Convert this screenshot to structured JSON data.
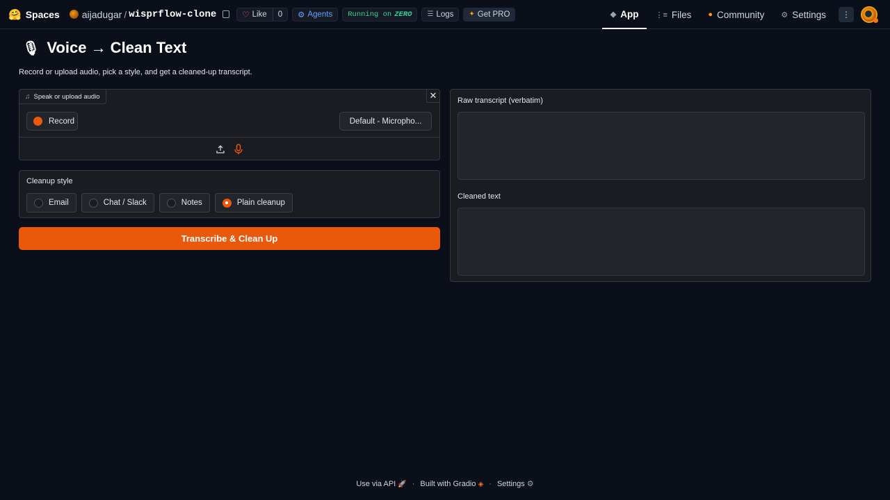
{
  "topbar": {
    "brand": "Spaces",
    "owner": "aijadugar",
    "slash": "/",
    "repo_name": "wisprflow-clone",
    "like_label": "Like",
    "like_count": "0",
    "agents_label": "Agents",
    "running_label": "Running on",
    "running_hw": "ZERO",
    "logs_label": "Logs",
    "pro_label": "Get PRO",
    "tabs": [
      {
        "label": "App",
        "icon": "cube-icon",
        "active": true
      },
      {
        "label": "Files",
        "icon": "files-icon",
        "active": false
      },
      {
        "label": "Community",
        "icon": "community-icon",
        "active": false
      },
      {
        "label": "Settings",
        "icon": "gear-icon",
        "active": false
      }
    ]
  },
  "page": {
    "title": "Voice → Clean Text",
    "description": "Record or upload audio, pick a style, and get a cleaned-up transcript."
  },
  "audio": {
    "label": "Speak or upload audio",
    "record_label": "Record",
    "device": "Default - Micropho..."
  },
  "style": {
    "title": "Cleanup style",
    "options": [
      "Email",
      "Chat / Slack",
      "Notes",
      "Plain cleanup"
    ],
    "selected": "Plain cleanup"
  },
  "submit_label": "Transcribe & Clean Up",
  "outputs": {
    "raw_label": "Raw transcript (verbatim)",
    "raw_value": "",
    "clean_label": "Cleaned text",
    "clean_value": ""
  },
  "footer": {
    "api": "Use via API",
    "built": "Built with Gradio",
    "settings": "Settings",
    "separator": "·"
  },
  "colors": {
    "accent": "#ea580c",
    "background": "#0b0f19",
    "panel": "#1a1c22"
  }
}
